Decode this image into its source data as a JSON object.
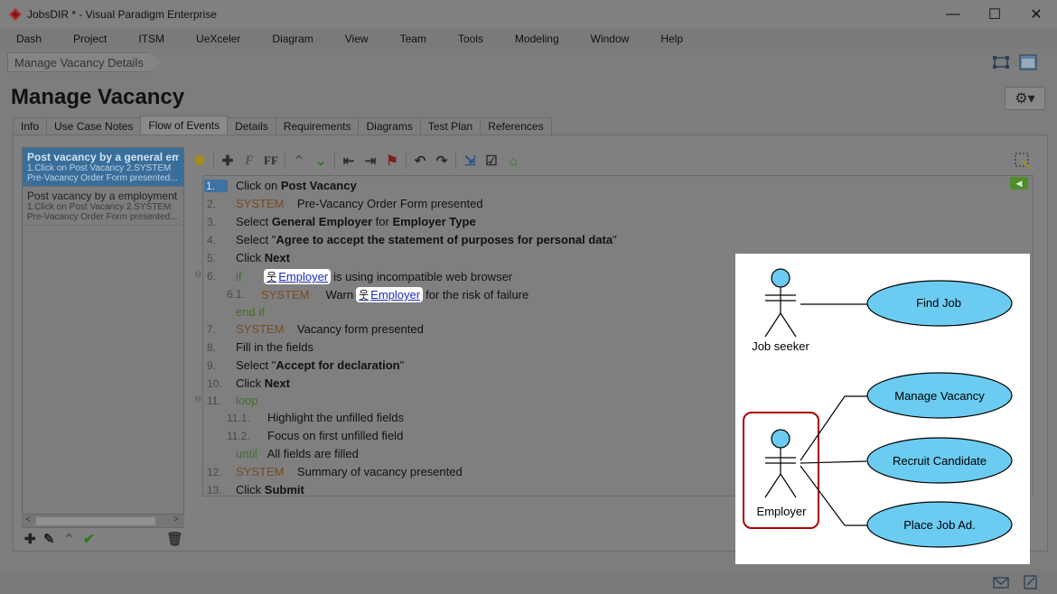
{
  "window": {
    "title": "JobsDIR * - Visual Paradigm Enterprise",
    "minimize": "—",
    "maximize": "☐",
    "close": "✕"
  },
  "menu": [
    "Dash",
    "Project",
    "ITSM",
    "UeXceler",
    "Diagram",
    "View",
    "Team",
    "Tools",
    "Modeling",
    "Window",
    "Help"
  ],
  "breadcrumb": "Manage Vacancy Details",
  "page_title": "Manage Vacancy",
  "gear_label": "⚙▾",
  "tabs": [
    "Info",
    "Use Case Notes",
    "Flow of Events",
    "Details",
    "Requirements",
    "Diagrams",
    "Test Plan",
    "References"
  ],
  "flows": [
    {
      "title": "Post vacancy by a general em...",
      "line1": "1.Click on Post Vacancy 2.SYSTEM",
      "line2": "Pre-Vacancy Order Form presented..."
    },
    {
      "title": "Post vacancy by a employment agen",
      "line1": "1.Click on Post Vacancy 2.SYSTEM",
      "line2": "Pre-Vacancy Order Form presented..."
    }
  ],
  "steps": {
    "s1": {
      "num": "1.",
      "a": "Click on ",
      "b": "Post Vacancy"
    },
    "s2": {
      "num": "2.",
      "kw": "SYSTEM",
      "text": "Pre-Vacancy Order Form presented"
    },
    "s3": {
      "num": "3.",
      "a": "Select ",
      "b1": "General Employer",
      "c": " for ",
      "b2": "Employer Type"
    },
    "s4": {
      "num": "4.",
      "a": "Select \"",
      "b": "Agree to accept the statement of purposes for personal data",
      "c": "\""
    },
    "s5": {
      "num": "5.",
      "a": "Click ",
      "b": "Next"
    },
    "s6": {
      "num": "6.",
      "kw": "if",
      "actor": "Employer",
      "rest": "is using incompatible web browser"
    },
    "s61": {
      "num": "6.1.",
      "kw": "SYSTEM",
      "a": "Warn",
      "actor": "Employer",
      "rest": "for the risk of failure"
    },
    "endif": {
      "kw": "end if"
    },
    "s7": {
      "num": "7.",
      "kw": "SYSTEM",
      "text": "Vacancy form presented"
    },
    "s8": {
      "num": "8.",
      "text": "Fill in the fields"
    },
    "s9": {
      "num": "9.",
      "a": "Select \"",
      "b": "Accept for declaration",
      "c": "\""
    },
    "s10": {
      "num": "10.",
      "a": "Click ",
      "b": "Next"
    },
    "s11": {
      "num": "11.",
      "kw": "loop"
    },
    "s111": {
      "num": "11.1.",
      "text": "Highlight the unfilled fields"
    },
    "s112": {
      "num": "11.2.",
      "text": "Focus on first unfilled field"
    },
    "until": {
      "kw": "until",
      "text": "All fields are filled"
    },
    "s12": {
      "num": "12.",
      "kw": "SYSTEM",
      "text": "Summary of vacancy presented"
    },
    "s13": {
      "num": "13.",
      "a": "Click ",
      "b": "Submit"
    }
  },
  "diagram": {
    "actors": [
      "Job seeker",
      "Employer"
    ],
    "use_cases": [
      "Find Job",
      "Manage Vacancy",
      "Recruit Candidate",
      "Place Job Ad."
    ],
    "colors": {
      "use_case_fill": "#6ccbf0",
      "actor_head": "#6ccbf0",
      "highlight_border": "#a80000"
    }
  }
}
